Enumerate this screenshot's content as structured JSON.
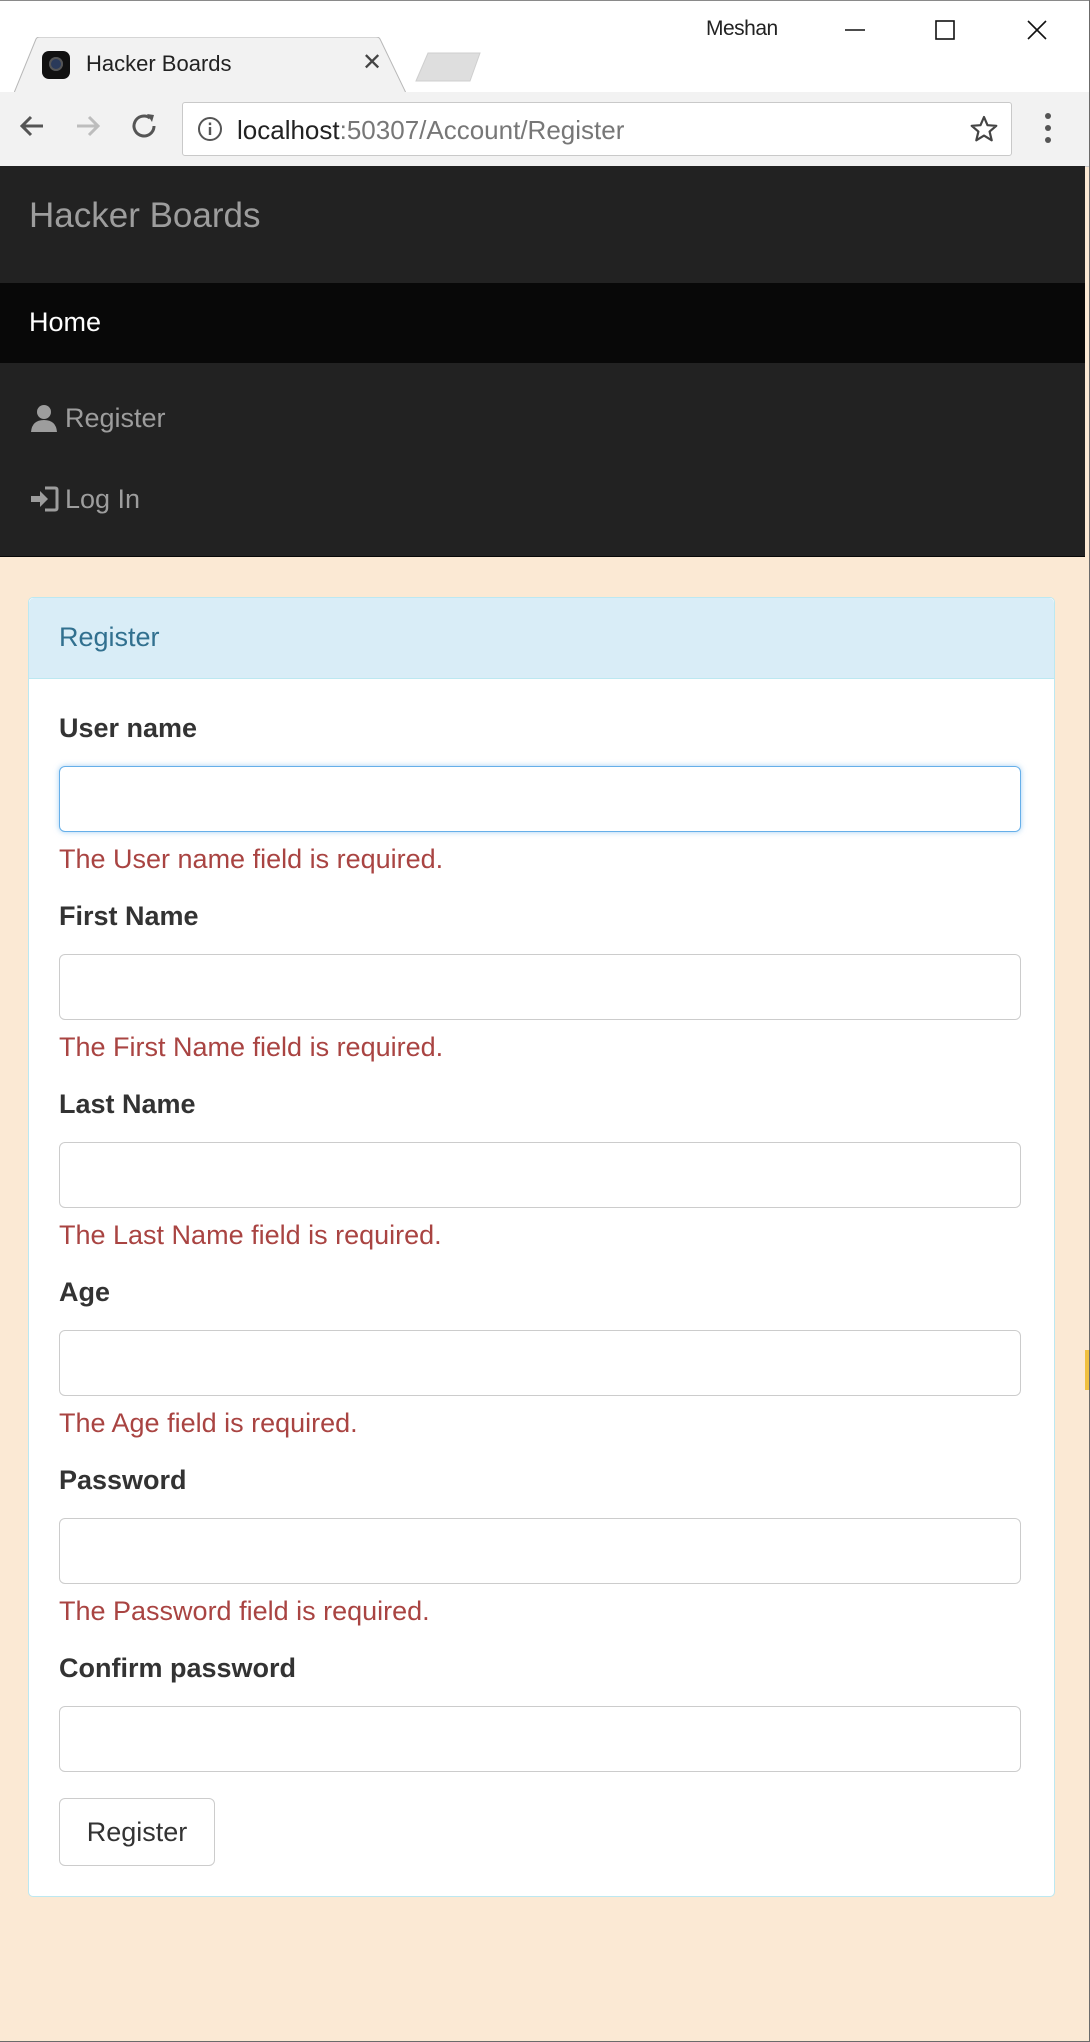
{
  "browser": {
    "tab_title": "Hacker Boards",
    "profile_name": "Meshan",
    "url_host": "localhost",
    "url_rest": ":50307/Account/Register"
  },
  "site": {
    "brand": "Hacker Boards",
    "nav": {
      "home": "Home",
      "register": "Register",
      "login": "Log In"
    }
  },
  "panel": {
    "title": "Register",
    "fields": [
      {
        "label": "User name",
        "value": "",
        "error": "The User name field is required."
      },
      {
        "label": "First Name",
        "value": "",
        "error": "The First Name field is required."
      },
      {
        "label": "Last Name",
        "value": "",
        "error": "The Last Name field is required."
      },
      {
        "label": "Age",
        "value": "",
        "error": "The Age field is required."
      },
      {
        "label": "Password",
        "value": "",
        "error": "The Password field is required."
      },
      {
        "label": "Confirm password",
        "value": ""
      }
    ],
    "submit_label": "Register"
  },
  "colors": {
    "page_bg": "#fbe9d4",
    "navbar_bg": "#222222",
    "panel_heading_bg": "#d9edf7",
    "error_text": "#a94442"
  },
  "icons": {
    "register": "user-icon",
    "login": "log-in-icon"
  }
}
